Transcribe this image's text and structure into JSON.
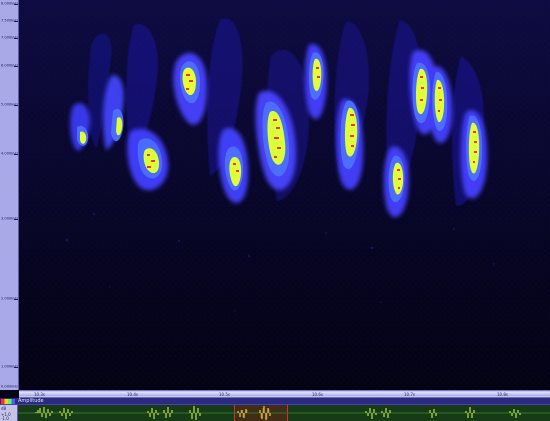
{
  "axis": {
    "freq_labels": [
      "8.000kHz",
      "7.500kHz",
      "7.000kHz",
      "6.000kHz",
      "5.000kHz",
      "4.000kHz",
      "3.000kHz",
      "2.000kHz",
      "1.000kHz",
      "0.000kHz"
    ],
    "time_labels": [
      "10.3s",
      "10.4s",
      "10.5s",
      "10.6s",
      "10.7s",
      "10.8s"
    ]
  },
  "track": {
    "name": "Amplitude",
    "mode_label": "dB",
    "amp_max": "+1.0",
    "amp_min": "-1.0"
  },
  "colors": {
    "background": "#060417",
    "noise": "#2320b8",
    "low": "#4b4fff",
    "mid": "#d7ff32",
    "high": "#ff2a2a",
    "waveform": "#e6ff4d"
  },
  "spectrogram_palette": [
    "blue",
    "cyan",
    "yellow-green",
    "red"
  ]
}
